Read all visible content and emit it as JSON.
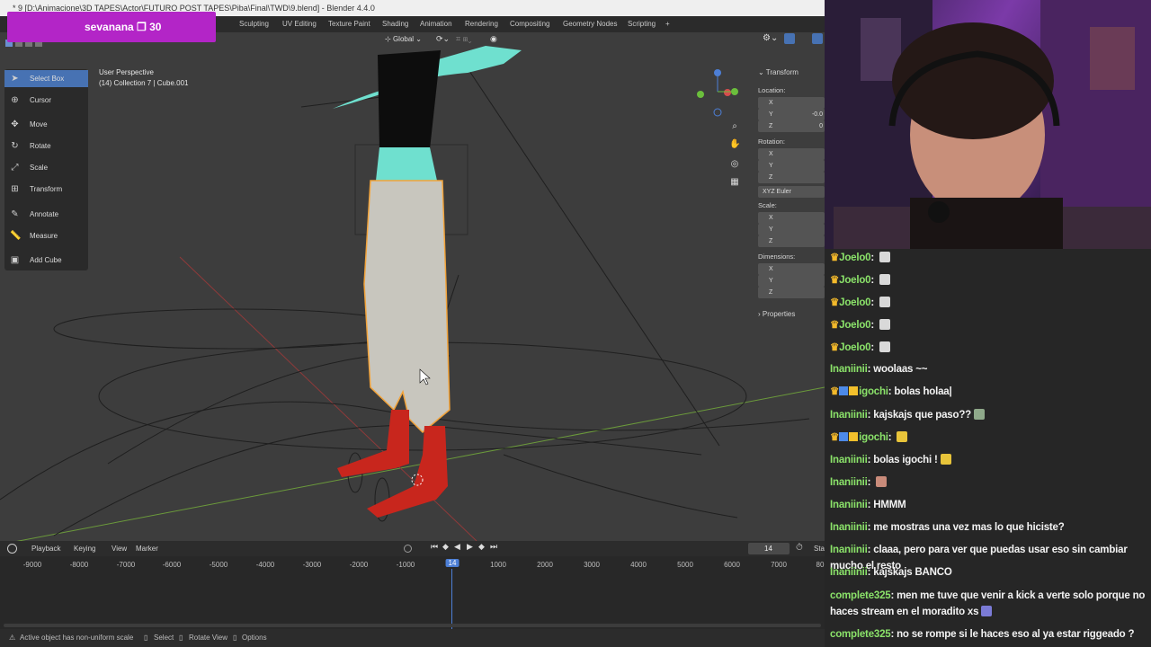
{
  "blender": {
    "title": "* 9 [D:\\Animacione\\3D TAPES\\Actor\\FUTURO POST TAPES\\Piba\\Final\\TWD\\9.blend] - Blender 4.4.0",
    "workspace_tabs": [
      "Sculpting",
      "UV Editing",
      "Texture Paint",
      "Shading",
      "Animation",
      "Rendering",
      "Compositing",
      "Geometry Nodes",
      "Scripting",
      "+"
    ],
    "transform_orientation": "Global",
    "overlay_badge": {
      "text": "sevanana ❐ 30",
      "color": "#b325c7"
    },
    "toolbar": [
      {
        "label": "Select Box",
        "icon": "cursor-arrow-icon",
        "active": true
      },
      {
        "label": "Cursor",
        "icon": "crosshair-icon",
        "active": false
      },
      {
        "label": "Move",
        "icon": "move-arrows-icon",
        "active": false
      },
      {
        "label": "Rotate",
        "icon": "rotate-icon",
        "active": false
      },
      {
        "label": "Scale",
        "icon": "scale-icon",
        "active": false
      },
      {
        "label": "Transform",
        "icon": "transform-icon",
        "active": false
      },
      {
        "label": "Annotate",
        "icon": "pencil-icon",
        "active": false
      },
      {
        "label": "Measure",
        "icon": "ruler-icon",
        "active": false
      },
      {
        "label": "Add Cube",
        "icon": "cube-icon",
        "active": false
      }
    ],
    "viewport_info": {
      "perspective": "User Perspective",
      "collection": "(14) Collection 7 | Cube.001"
    },
    "n_panel": {
      "transform_header": "Transform",
      "location_label": "Location:",
      "location": {
        "x": "",
        "y": "-0.0",
        "z": "0"
      },
      "rotation_label": "Rotation:",
      "rotation_mode": "XYZ Euler",
      "scale_label": "Scale:",
      "dimensions_label": "Dimensions:",
      "properties_label": "Properties",
      "axes": [
        "X",
        "Y",
        "Z"
      ]
    },
    "timeline": {
      "menus": [
        "Playback",
        "Keying",
        "View",
        "Marker"
      ],
      "current_frame": "14",
      "ticks": [
        "-9000",
        "-8000",
        "-7000",
        "-6000",
        "-5000",
        "-4000",
        "-3000",
        "-2000",
        "-1000",
        "14",
        "1000",
        "2000",
        "3000",
        "4000",
        "5000",
        "6000",
        "7000",
        "80"
      ],
      "playhead_color": "#4d7fd6",
      "start_label": "Sta"
    },
    "status_bar": {
      "warning": "Active object has non-uniform scale",
      "select": "Select",
      "rotate_view": "Rotate View",
      "options": "Options"
    },
    "colors": {
      "selection_outline": "#f2a33a",
      "accent": "#4772b3",
      "mesh": "#c8c6be",
      "boots": "#c8261d",
      "skin": "#6fe0cf"
    }
  },
  "chat": {
    "messages": [
      {
        "user": "Joelo0",
        "text": "",
        "emote_color": "#d9d9d9",
        "crown": true,
        "badges": []
      },
      {
        "user": "Joelo0",
        "text": "",
        "emote_color": "#d9d9d9",
        "crown": true,
        "badges": []
      },
      {
        "user": "Joelo0",
        "text": "",
        "emote_color": "#d9d9d9",
        "crown": true,
        "badges": []
      },
      {
        "user": "Joelo0",
        "text": "",
        "emote_color": "#d9d9d9",
        "crown": true,
        "badges": []
      },
      {
        "user": "Joelo0",
        "text": "",
        "emote_color": "#d9d9d9",
        "crown": true,
        "badges": []
      },
      {
        "user": "Inaniinii",
        "text": "woolaas ~~",
        "emote_color": "",
        "crown": false,
        "badges": []
      },
      {
        "user": "igochi",
        "text": "bolas holaa|",
        "emote_color": "",
        "crown": true,
        "badges": [
          "#4d8ae8",
          "#f3c02c"
        ]
      },
      {
        "user": "Inaniinii",
        "text": "kajskajs que paso??",
        "emote_color": "#8fa98a",
        "crown": false,
        "badges": []
      },
      {
        "user": "igochi",
        "text": "",
        "emote_color": "#e8c43a",
        "crown": true,
        "badges": [
          "#4d8ae8",
          "#f3c02c"
        ]
      },
      {
        "user": "Inaniinii",
        "text": "bolas igochi !",
        "emote_color": "#e8c43a",
        "crown": false,
        "badges": []
      },
      {
        "user": "Inaniinii",
        "text": "",
        "emote_color": "#c98b7a",
        "crown": false,
        "badges": []
      },
      {
        "user": "Inaniinii",
        "text": "HMMM",
        "emote_color": "",
        "crown": false,
        "badges": []
      },
      {
        "user": "Inaniinii",
        "text": "me mostras una vez mas lo que hiciste?",
        "emote_color": "",
        "crown": false,
        "badges": []
      },
      {
        "user": "Inaniinii",
        "text": "claaa, pero para ver que puedas usar eso sin cambiar mucho el resto",
        "emote_color": "",
        "crown": false,
        "badges": []
      },
      {
        "user": "Inaniinii",
        "text": "kajskajs BANCO",
        "emote_color": "",
        "crown": false,
        "badges": []
      },
      {
        "user": "complete325",
        "text": "men me tuve que venir a kick a verte solo porque no haces stream en el moradito xs",
        "emote_color": "#7b7bd6",
        "crown": false,
        "badges": []
      },
      {
        "user": "complete325",
        "text": "no se rompe si le haces eso al ya estar riggeado ?",
        "emote_color": "",
        "crown": false,
        "badges": []
      }
    ]
  }
}
